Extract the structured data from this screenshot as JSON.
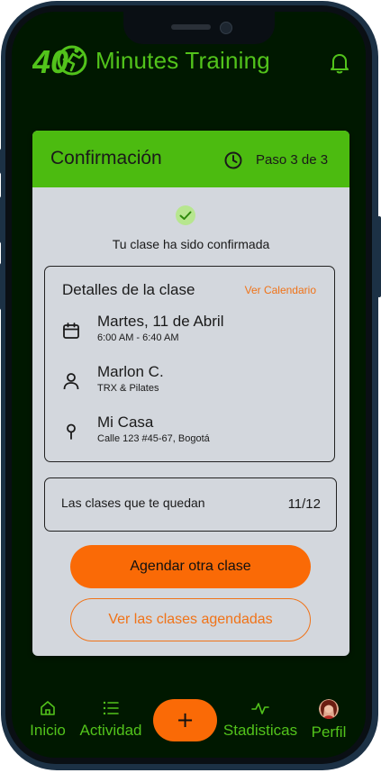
{
  "header": {
    "logo_text": "40",
    "app_title": "Minutes Training"
  },
  "card": {
    "title": "Confirmación",
    "step": "Paso 3 de 3",
    "confirmation_message": "Tu clase ha sido confirmada",
    "details": {
      "title": "Detalles de la clase",
      "calendar_link": "Ver Calendario",
      "date": {
        "main": "Martes, 11 de Abril",
        "sub": "6:00 AM - 6:40 AM"
      },
      "trainer": {
        "main": "Marlon C.",
        "sub": "TRX & Pilates"
      },
      "location": {
        "main": "Mi Casa",
        "sub": "Calle 123 #45-67, Bogotá"
      }
    },
    "remaining": {
      "label": "Las clases que te quedan",
      "count": "11/12"
    },
    "primary_button": "Agendar otra clase",
    "secondary_button": "Ver las clases agendadas"
  },
  "nav": {
    "items": [
      {
        "label": "Inicio",
        "icon": "home-icon"
      },
      {
        "label": "Actividad",
        "icon": "list-icon"
      },
      {
        "label": "+",
        "icon": "plus-icon"
      },
      {
        "label": "Stadisticas",
        "icon": "activity-icon"
      },
      {
        "label": "Perfil",
        "icon": "avatar"
      }
    ]
  },
  "colors": {
    "brand_green": "#52c31b",
    "header_green": "#4cbb10",
    "accent_orange": "#fa6a06",
    "background": "#001800",
    "card_bg": "#d3d7dd"
  }
}
